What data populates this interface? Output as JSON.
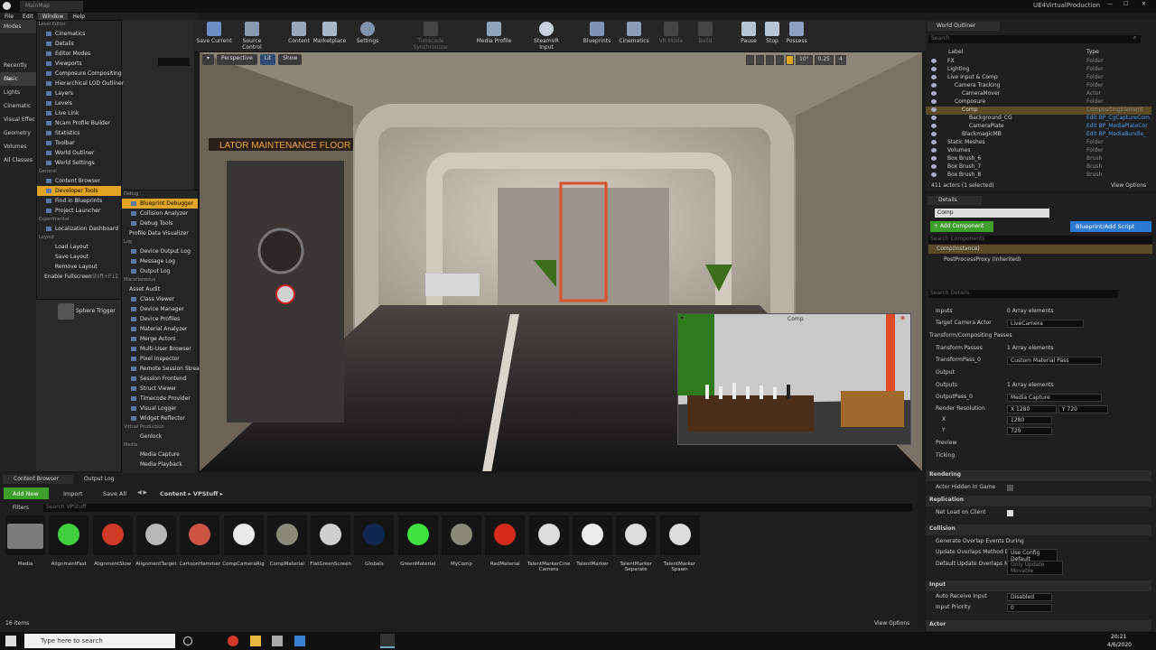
{
  "window": {
    "title": "UE4VirtualProduction",
    "doc_tab": "MainMap"
  },
  "menubar": [
    "File",
    "Edit",
    "Window",
    "Help"
  ],
  "modes": {
    "label": "Modes",
    "search": "Search Class",
    "categories": [
      "Recently Pla",
      "Basic",
      "Lights",
      "Cinematic",
      "Visual Effec",
      "Geometry",
      "Volumes",
      "All Classes"
    ]
  },
  "window_menu": {
    "header_level_editor": "Level Editor",
    "level_editor_items": [
      "Cinematics",
      "Details",
      "Editor Modes",
      "Viewports",
      "Composure Compositing",
      "Hierarchical LOD Outliner",
      "Layers",
      "Levels",
      "Live Link",
      "Ncam Profile Builder",
      "Statistics",
      "Toolbar",
      "World Outliner",
      "World Settings"
    ],
    "header_general": "General",
    "general_items": [
      "Content Browser",
      "Developer Tools",
      "Find in Blueprints",
      "Project Launcher"
    ],
    "header_experimental": "Experimental",
    "experimental_items": [
      "Localization Dashboard"
    ],
    "header_layout": "Layout",
    "layout_items": [
      "Load Layout",
      "Save Layout",
      "Remove Layout"
    ],
    "fullscreen": "Enable Fullscreen",
    "fullscreen_shortcut": "Shift+F11"
  },
  "dev_tools_menu": {
    "header_debug": "Debug",
    "debug_items": [
      "Blueprint Debugger",
      "Collision Analyzer",
      "Debug Tools",
      "Profile Data Visualizer"
    ],
    "header_log": "Log",
    "log_items": [
      "Device Output Log",
      "Message Log",
      "Output Log"
    ],
    "header_misc": "Miscellaneous",
    "misc_items": [
      "Asset Audit",
      "Class Viewer",
      "Device Manager",
      "Device Profiles",
      "Material Analyzer",
      "Merge Actors",
      "Multi-User Browser",
      "Pixel Inspector",
      "Remote Session Stream",
      "Session Frontend",
      "Struct Viewer",
      "Timecode Provider",
      "Visual Logger",
      "Widget Reflector"
    ],
    "header_vp": "Virtual Production",
    "vp_items": [
      "Genlock"
    ],
    "header_media": "Media",
    "media_items": [
      "Media Capture",
      "Media Playback"
    ]
  },
  "placed_item": "Sphere Trigger",
  "toolbar": [
    "Save Current",
    "Source Control",
    "Content",
    "Marketplace",
    "Settings",
    "Timecode Synchronizer",
    "Media Profile",
    "SteamVR Input",
    "Blueprints",
    "Cinematics",
    "VR Mode",
    "Build",
    "Pause",
    "Stop",
    "Possess"
  ],
  "viewport": {
    "perspective": "Perspective",
    "lit": "Lit",
    "show": "Show",
    "sign": "LATOR MAINTENANCE FLOOR",
    "snap_angle": "10°",
    "snap_scale": "0.25",
    "cam_speed": "4",
    "pip_title": "Comp"
  },
  "outliner": {
    "title": "World Outliner",
    "search": "Search",
    "col_label": "Label",
    "col_type": "Type",
    "rows": [
      {
        "label": "FX",
        "type": "Folder"
      },
      {
        "label": "Lighting",
        "type": "Folder"
      },
      {
        "label": "Live Input & Comp",
        "type": "Folder"
      },
      {
        "label": "Camera Tracking",
        "type": "Folder"
      },
      {
        "label": "CameraMover",
        "type": "Actor"
      },
      {
        "label": "Composure",
        "type": "Folder"
      },
      {
        "label": "Comp",
        "type": "CompositingElement"
      },
      {
        "label": "Background_CG",
        "type": "Edit BP_CgCaptureCom"
      },
      {
        "label": "CameraPlate",
        "type": "Edit BP_MediaPlateCor"
      },
      {
        "label": "BlackmagicMB",
        "type": "Edit BP_MediaBundle_"
      },
      {
        "label": "Static Meshes",
        "type": "Folder"
      },
      {
        "label": "Volumes",
        "type": "Folder"
      },
      {
        "label": "Box Brush_6",
        "type": "Brush"
      },
      {
        "label": "Box Brush_7",
        "type": "Brush"
      },
      {
        "label": "Box Brush_8",
        "type": "Brush"
      }
    ],
    "count": "411 actors (1 selected)",
    "view_options": "View Options"
  },
  "details": {
    "title": "Details",
    "name": "Comp",
    "add_component": "+ Add Component",
    "bp_button": "Blueprint/Add Script",
    "search_components": "Search Components",
    "instance": "Comp(Instance)",
    "proxy": "PostProcessProxy (Inherited)",
    "search_details": "Search Details",
    "inputs": "Inputs",
    "inputs_val": "0 Array elements",
    "target_camera": "Target Camera Actor",
    "target_camera_val": "LiveCamera",
    "transform_section": "Transform/Compositing Passes",
    "transform_passes": "Transform Passes",
    "transform_passes_val": "1 Array elements",
    "transform_pass0": "TransformPass_0",
    "transform_pass0_val": "Custom Material Pass",
    "output": "Output",
    "outputs": "Outputs",
    "outputs_val": "1 Array elements",
    "output_pass0": "OutputPass_0",
    "output_pass0_val": "Media Capture",
    "render_res": "Render Resolution",
    "res_x_label": "X",
    "res_x": "1280",
    "res_y_label": "Y",
    "res_y": "720",
    "x": "X",
    "x_val": "1280",
    "y": "Y",
    "y_val": "720",
    "preview": "Preview",
    "ticking": "Ticking",
    "rendering": "Rendering",
    "hidden_in_game": "Actor Hidden In Game",
    "replication": "Replication",
    "net_load": "Net Load on Client",
    "collision": "Collision",
    "gen_overlap": "Generate Overlap Events During",
    "update_overlaps": "Update Overlaps Method During",
    "update_overlaps_val": "Use Config Default",
    "default_update": "Default Update Overlaps Metho",
    "default_update_val": "Only Update Movable",
    "input": "Input",
    "auto_receive": "Auto Receive Input",
    "auto_receive_val": "Disabled",
    "input_priority": "Input Priority",
    "input_priority_val": "0",
    "actor": "Actor"
  },
  "content_browser": {
    "tabs": [
      "Content Browser",
      "Output Log"
    ],
    "add_new": "Add New",
    "import": "Import",
    "save_all": "Save All",
    "path": [
      "Content",
      "VPStuff"
    ],
    "filters": "Filters",
    "search": "Search VPStuff",
    "assets": [
      "Media",
      "AlignmentFast",
      "AlignmentSlow",
      "AlignmentTarget",
      "CartoonHammer",
      "CompCameraRig",
      "CompMaterial",
      "FlatGreenScreen",
      "Globals",
      "GreenMaterial",
      "MyComp",
      "RedMaterial",
      "TalentMarkerCine Camera",
      "TalentMarker",
      "TalentMarker Separate",
      "TalentMarker Spawn"
    ],
    "count": "16 items",
    "view_options": "View Options"
  },
  "taskbar": {
    "search": "Type here to search",
    "time": "20:21",
    "date": "4/6/2020"
  },
  "colors": {
    "accent": "#e1a423",
    "blue": "#2a7ad5",
    "add_green": "#3f9f2d",
    "selected_row": "#5b4b27"
  }
}
